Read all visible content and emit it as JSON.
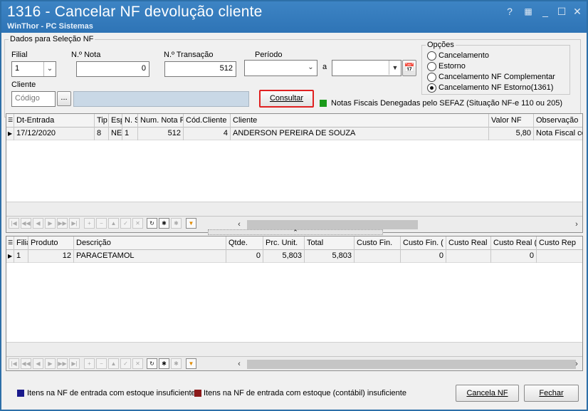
{
  "window": {
    "title": "1316 - Cancelar NF devolução cliente",
    "subtitle": "WinThor - PC Sistemas",
    "controls": {
      "help": "?",
      "minimize": "_",
      "maximize": "☐",
      "close": "✕"
    }
  },
  "selection": {
    "group_label": "Dados para Seleção NF",
    "filial": {
      "label": "Filial",
      "value": "1"
    },
    "nota": {
      "label": "N.º Nota",
      "value": "0"
    },
    "transacao": {
      "label": "N.º Transação",
      "value": "512"
    },
    "periodo": {
      "label": "Período",
      "from": "",
      "separator": "a",
      "to": ""
    },
    "cliente": {
      "label": "Cliente",
      "placeholder": "Código",
      "browse_label": "...",
      "name": ""
    },
    "consultar_label": "Consultar",
    "denegadas_text": "Notas Fiscais Denegadas pelo SEFAZ (Situação NF-e 110 ou 205)",
    "denegadas_color": "#1a9a1a"
  },
  "options": {
    "label": "Opções",
    "items": [
      {
        "label": "Cancelamento",
        "selected": false
      },
      {
        "label": "Estorno",
        "selected": false
      },
      {
        "label": "Cancelamento NF Complementar",
        "selected": false
      },
      {
        "label": "Cancelamento NF Estorno(1361)",
        "selected": true
      }
    ]
  },
  "grid_nf": {
    "columns": [
      "Dt-Entrada",
      "Tip",
      "Esp",
      "N. S",
      "Num. Nota F",
      "Cód.Cliente",
      "Cliente",
      "Valor NF",
      "Observação"
    ],
    "rows": [
      [
        "17/12/2020",
        "8",
        "NE",
        "1",
        "512",
        "4",
        "ANDERSON PEREIRA DE SOUZA",
        "5,80",
        "Nota Fiscal co"
      ]
    ]
  },
  "grid_items": {
    "columns": [
      "Filia",
      "Produto",
      "Descrição",
      "Qtde.",
      "Prc. Unit.",
      "Total",
      "Custo Fin.",
      "Custo Fin. (",
      "Custo Real",
      "Custo Real (",
      "Custo Rep"
    ],
    "rows": [
      [
        "1",
        "12",
        "PARACETAMOL",
        "0",
        "5,803",
        "5,803",
        "",
        "0",
        "",
        "0",
        ""
      ]
    ]
  },
  "legend": [
    {
      "text": "Itens na NF de entrada com estoque insuficiente",
      "color": "#1a1a8c"
    },
    {
      "text": "Itens na NF de entrada com estoque (contábil) insuficiente",
      "color": "#8c1a1a"
    }
  ],
  "footer": {
    "cancela_label": "Cancela NF",
    "fechar_label": "Fechar"
  },
  "colors": {
    "titlebar": "#2e74b6",
    "highlight_border": "#e02020"
  }
}
